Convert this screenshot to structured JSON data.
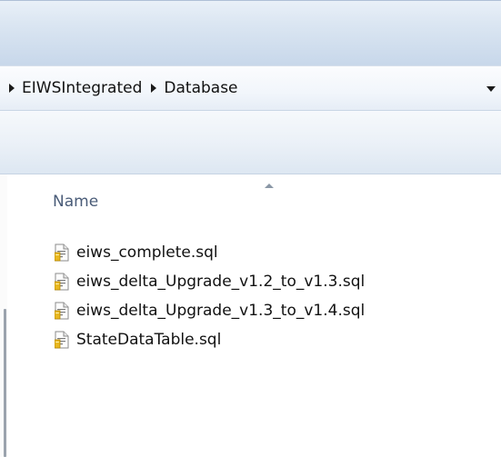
{
  "breadcrumb": {
    "items": [
      {
        "label": "EIWSIntegrated"
      },
      {
        "label": "Database"
      }
    ]
  },
  "file_list": {
    "column_header": "Name",
    "files": [
      {
        "name": "eiws_complete.sql",
        "icon": "sql-script-file-icon"
      },
      {
        "name": "eiws_delta_Upgrade_v1.2_to_v1.3.sql",
        "icon": "sql-script-file-icon"
      },
      {
        "name": "eiws_delta_Upgrade_v1.3_to_v1.4.sql",
        "icon": "sql-script-file-icon"
      },
      {
        "name": "StateDataTable.sql",
        "icon": "sql-script-file-icon"
      }
    ]
  },
  "colors": {
    "header_text": "#4a5c78",
    "chrome_gradient_top": "#e9f0f8",
    "chrome_gradient_bottom": "#c7d7ea"
  }
}
